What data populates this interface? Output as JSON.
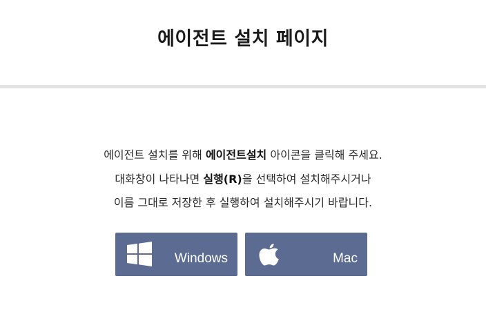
{
  "header": {
    "title": "에이전트 설치 페이지"
  },
  "instructions": {
    "line1_before": "에이전트 설치를 위해 ",
    "line1_bold": "에이전트설치",
    "line1_after": " 아이콘을 클릭해 주세요.",
    "line2_before": "대화창이 나타나면 ",
    "line2_bold": "실행(R)",
    "line2_after": "을 선택하여 설치해주시거나",
    "line3": "이름 그대로 저장한 후 실행하여 설치해주시기 바랍니다."
  },
  "buttons": {
    "windows_label": "Windows",
    "mac_label": "Mac",
    "windows_icon": "windows-logo-icon",
    "mac_icon": "apple-logo-icon"
  },
  "colors": {
    "button_bg": "#5c6b91",
    "divider": "#e3e3e3"
  }
}
